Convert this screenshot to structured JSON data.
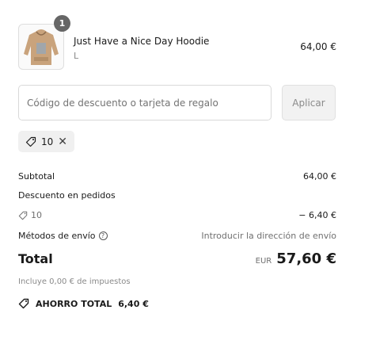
{
  "line_item": {
    "quantity": "1",
    "name": "Just Have a Nice Day Hoodie",
    "variant": "L",
    "price": "64,00 €",
    "image_icon": "hoodie-thumbnail"
  },
  "discount": {
    "placeholder": "Código de descuento o tarjeta de regalo",
    "value": "",
    "apply_label": "Aplicar",
    "applied_code": "10",
    "tag_icon": "tag-icon",
    "remove_icon": "close-icon"
  },
  "summary": {
    "subtotal_label": "Subtotal",
    "subtotal_value": "64,00 €",
    "order_discount_label": "Descuento en pedidos",
    "discount_code": "10",
    "discount_value": "− 6,40 €",
    "shipping_label": "Métodos de envío",
    "shipping_value": "Introducir la dirección de envío",
    "total_label": "Total",
    "currency": "EUR",
    "total_value": "57,60 €",
    "taxes_note": "Incluye 0,00 € de impuestos",
    "savings_label": "AHORRO TOTAL",
    "savings_value": "6,40 €"
  },
  "colors": {
    "badge": "#666666",
    "muted_text": "#707070",
    "border": "#d9d9d9",
    "tag_bg": "#f0f0f0"
  }
}
